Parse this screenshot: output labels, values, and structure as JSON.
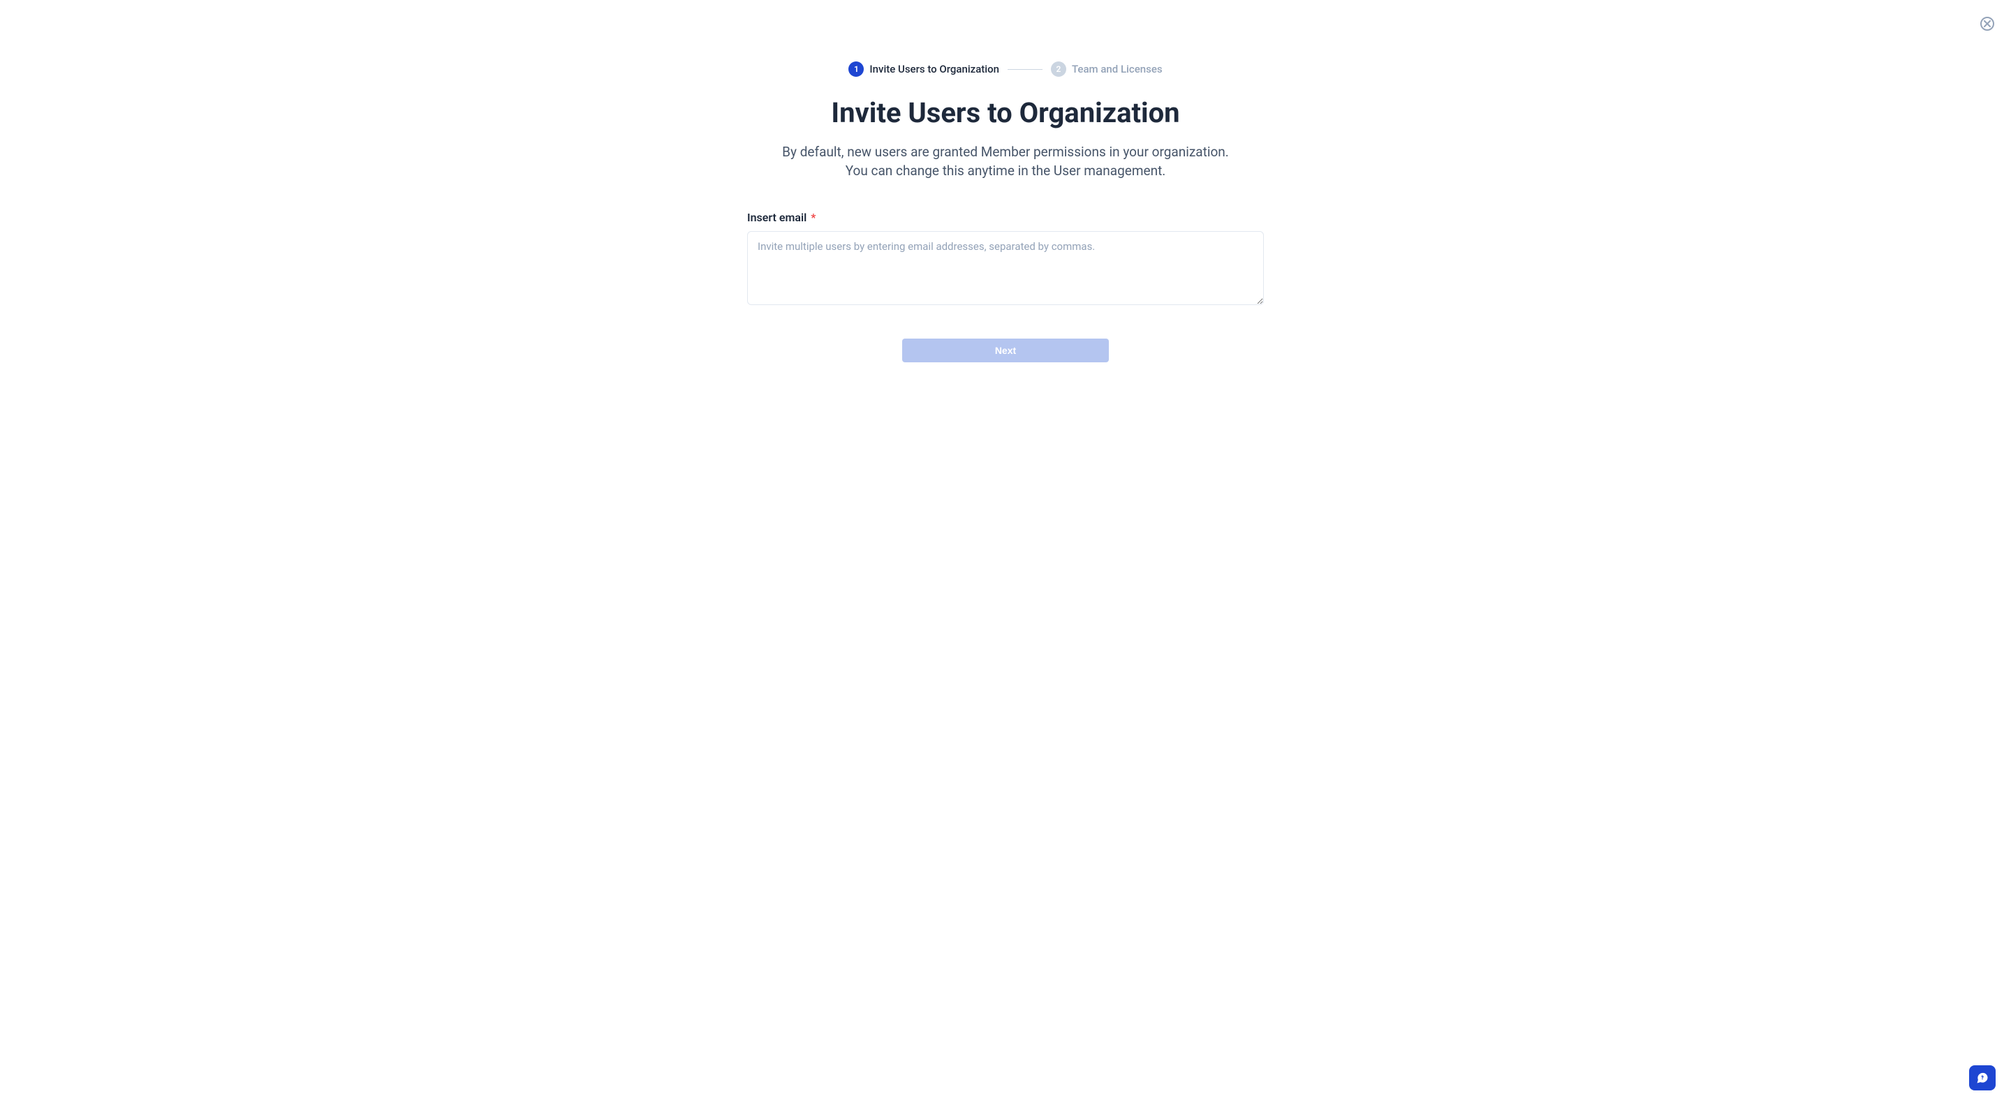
{
  "stepper": {
    "step1": {
      "number": "1",
      "label": "Invite Users to Organization"
    },
    "step2": {
      "number": "2",
      "label": "Team and Licenses"
    }
  },
  "page": {
    "title": "Invite Users to Organization",
    "description": "By default, new users are granted Member permissions in your organization. You can change this anytime in the User management."
  },
  "form": {
    "emailLabel": "Insert email",
    "emailPlaceholder": "Invite multiple users by entering email addresses, separated by commas.",
    "emailValue": ""
  },
  "buttons": {
    "next": "Next"
  }
}
